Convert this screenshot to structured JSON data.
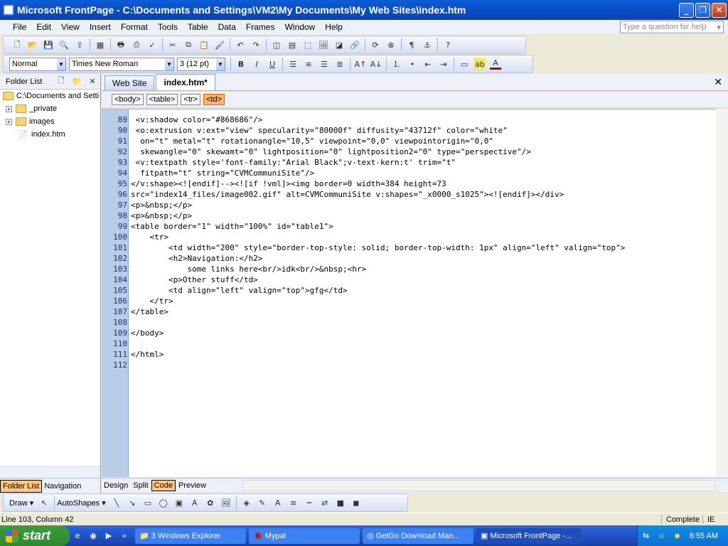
{
  "title": "Microsoft FrontPage - C:\\Documents and Settings\\VM2\\My Documents\\My Web Sites\\index.htm",
  "menu": [
    "File",
    "Edit",
    "View",
    "Insert",
    "Format",
    "Tools",
    "Table",
    "Data",
    "Frames",
    "Window",
    "Help"
  ],
  "help_placeholder": "Type a question for help",
  "format": {
    "style": "Normal",
    "font": "Times New Roman",
    "size": "3 (12 pt)"
  },
  "folder_list": {
    "title": "Folder List",
    "root": "C:\\Documents and Setti",
    "items": [
      "_private",
      "images",
      "index.htm"
    ]
  },
  "pane_tabs": [
    "Folder List",
    "Navigation"
  ],
  "doc_tabs": [
    "Web Site",
    "index.htm*"
  ],
  "quick_tags": [
    "<body>",
    "<table>",
    "<tr>",
    "<td>"
  ],
  "code_lines": [
    {
      "n": "89",
      "t": " <v:shadow color=\"#868686\"/>"
    },
    {
      "n": "90",
      "t": " <o:extrusion v:ext=\"view\" specularity=\"80000f\" diffusity=\"43712f\" color=\"white\""
    },
    {
      "n": "91",
      "t": "  on=\"t\" metal=\"t\" rotationangle=\"10,5\" viewpoint=\"0,0\" viewpointorigin=\"0,0\""
    },
    {
      "n": "92",
      "t": "  skewangle=\"0\" skewamt=\"0\" lightposition=\"0\" lightposition2=\"0\" type=\"perspective\"/>"
    },
    {
      "n": "93",
      "t": " <v:textpath style='font-family:\"Arial Black\";v-text-kern:t' trim=\"t\""
    },
    {
      "n": "94",
      "t": "  fitpath=\"t\" string=\"CVMCommuniSite\"/>"
    },
    {
      "n": "95",
      "t": "</v:shape><![endif]--><![if !vml]><img border=0 width=384 height=73"
    },
    {
      "n": "96",
      "t": "src=\"index14_files/image002.gif\" alt=CVMCommuniSite v:shapes=\"_x0000_s1025\"><![endif]></div>"
    },
    {
      "n": "97",
      "t": "<p>&nbsp;</p>"
    },
    {
      "n": "98",
      "t": "<p>&nbsp;</p>"
    },
    {
      "n": "99",
      "t": "<table border=\"1\" width=\"100%\" id=\"table1\">"
    },
    {
      "n": "100",
      "t": "    <tr>"
    },
    {
      "n": "101",
      "t": "        <td width=\"200\" style=\"border-top-style: solid; border-top-width: 1px\" align=\"left\" valign=\"top\">"
    },
    {
      "n": "102",
      "t": "        <h2>Navigation:</h2>"
    },
    {
      "n": "103",
      "t": "            some links here<br/>idk<br/>&nbsp;<hr>"
    },
    {
      "n": "104",
      "t": "        <p>Other stuff</td>"
    },
    {
      "n": "105",
      "t": "        <td align=\"left\" valign=\"top\">gfg</td>"
    },
    {
      "n": "106",
      "t": "    </tr>"
    },
    {
      "n": "107",
      "t": "</table>"
    },
    {
      "n": "108",
      "t": ""
    },
    {
      "n": "109",
      "t": "</body>"
    },
    {
      "n": "110",
      "t": ""
    },
    {
      "n": "111",
      "t": "</html>"
    },
    {
      "n": "112",
      "t": ""
    }
  ],
  "view_tabs": [
    "Design",
    "Split",
    "Code",
    "Preview"
  ],
  "draw": {
    "draw": "Draw",
    "autoshapes": "AutoShapes"
  },
  "status": {
    "position": "Line 103, Column 42",
    "complete": "Complete",
    "mode": "IE"
  },
  "taskbar": {
    "start": "start",
    "tasks": [
      "3 Windows Explorer",
      "Mypal",
      "GetGo Download Man...",
      "Microsoft FrontPage -..."
    ],
    "time": "8:55 AM"
  }
}
